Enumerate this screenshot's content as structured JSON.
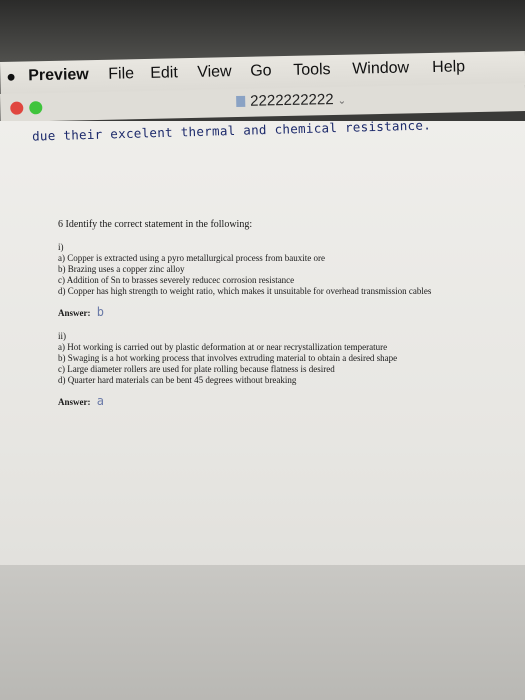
{
  "menubar": {
    "apple": "",
    "app_name": "Preview",
    "items": [
      "File",
      "Edit",
      "View",
      "Go",
      "Tools",
      "Window",
      "Help"
    ]
  },
  "window": {
    "title": "2222222222",
    "title_chevron": "⌄"
  },
  "document": {
    "handwritten_note": "due their excelent thermal and chemical resistance.",
    "question_title": "6 Identify the correct statement in the following:",
    "part1": {
      "label": "i)",
      "options": [
        "a) Copper is extracted using a pyro metallurgical process from bauxite ore",
        "b) Brazing uses a copper zinc alloy",
        "c) Addition of Sn to brasses severely reducec corrosion resistance",
        "d) Copper has high strength to weight ratio, which makes it unsuitable for overhead transmission cables"
      ],
      "answer_label": "Answer:",
      "answer_value": "b"
    },
    "part2": {
      "label": "ii)",
      "options": [
        "a) Hot working is carried out by plastic deformation at or near recrystallization temperature",
        "b) Swaging is a hot working process that involves extruding material to obtain a desired shape",
        "c) Large diameter rollers are used for plate rolling because flatness is desired",
        "d) Quarter hard materials can be bent 45 degrees without breaking"
      ],
      "answer_label": "Answer:",
      "answer_value": "a"
    }
  },
  "colors": {
    "ink": "#1c2a6b",
    "red_light": "#e0463f",
    "green_light": "#3fc43c"
  }
}
